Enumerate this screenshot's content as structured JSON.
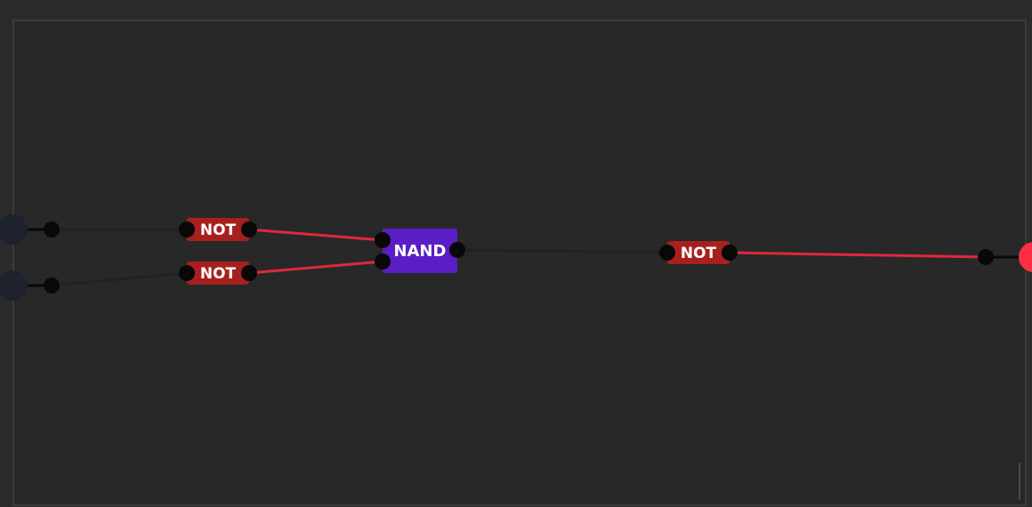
{
  "canvas": {
    "background": "#2b2b2b",
    "board_color": "#282828",
    "border_color": "#3c3c3c"
  },
  "colors": {
    "wire_off": "#1f2128",
    "wire_on": "#e0283c",
    "pin": "#080808",
    "not_gate": "#a8201e",
    "nand_gate": "#5a1ec4",
    "input_off": "#1e222c",
    "output_on": "#ff2e44"
  },
  "inputs": [
    {
      "id": "input-a",
      "state": "off"
    },
    {
      "id": "input-b",
      "state": "off"
    }
  ],
  "gates": [
    {
      "id": "not-1",
      "type": "NOT",
      "label": "NOT"
    },
    {
      "id": "not-2",
      "type": "NOT",
      "label": "NOT"
    },
    {
      "id": "nand-1",
      "type": "NAND",
      "label": "NAND"
    },
    {
      "id": "not-3",
      "type": "NOT",
      "label": "NOT"
    }
  ],
  "outputs": [
    {
      "id": "output-1",
      "state": "on"
    }
  ],
  "wires": [
    {
      "from": "input-a",
      "to": "not-1",
      "state": "off"
    },
    {
      "from": "input-b",
      "to": "not-2",
      "state": "off"
    },
    {
      "from": "not-1",
      "to": "nand-1",
      "state": "on"
    },
    {
      "from": "not-2",
      "to": "nand-1",
      "state": "on"
    },
    {
      "from": "nand-1",
      "to": "not-3",
      "state": "off"
    },
    {
      "from": "not-3",
      "to": "output-1",
      "state": "on"
    }
  ]
}
